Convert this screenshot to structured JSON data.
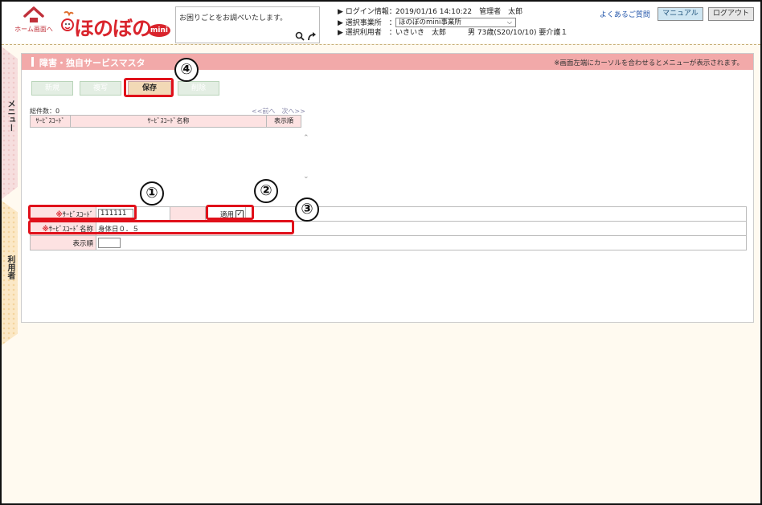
{
  "header": {
    "home_label": "ホーム画面へ",
    "logo_text": "ほのぼの",
    "logo_badge": "mini",
    "search_placeholder": "お困りごとをお調べいたします。",
    "login_label": "▶ ログイン情報：",
    "login_value": "2019/01/16 14:10:22　管理者　太郎",
    "office_label": "▶ 選択事業所　：",
    "office_value": "ほのぼのmini事業所",
    "user_label": "▶ 選択利用者　：",
    "user_value": "いきいき　太郎　　　男 73歳(S20/10/10) 要介護１",
    "faq": "よくあるご質問",
    "manual": "マニュアル",
    "logout": "ログアウト"
  },
  "sidebar": {
    "menu_label": "メニュー",
    "user_label": "利用者"
  },
  "page": {
    "title": "障害・独自サービスマスタ",
    "note": "※画面左端にカーソルを合わせるとメニューが表示されます。"
  },
  "toolbar": {
    "new": "新規",
    "copy": "複写",
    "save": "保存",
    "delete": "削除"
  },
  "list": {
    "count": "総件数：0",
    "pager": "<<前へ　次へ>>",
    "columns": [
      "ｻｰﾋﾞｽｺｰﾄﾞ",
      "ｻｰﾋﾞｽｺｰﾄﾞ名称",
      "表示順"
    ]
  },
  "form": {
    "code_label": "ｻｰﾋﾞｽｺｰﾄﾞ",
    "code_value": "111111",
    "apply_label": "適用",
    "apply_checked": true,
    "name_label": "ｻｰﾋﾞｽｺｰﾄﾞ名称",
    "name_value": "身体日０．５",
    "order_label": "表示順",
    "order_value": "",
    "required_mark": "※"
  },
  "callouts": [
    "①",
    "②",
    "③",
    "④"
  ],
  "colors": {
    "title_bar": "#f2a9a9",
    "label_bg": "#fde2e2",
    "highlight": "#e0101a",
    "logo_red": "#d9242c"
  }
}
